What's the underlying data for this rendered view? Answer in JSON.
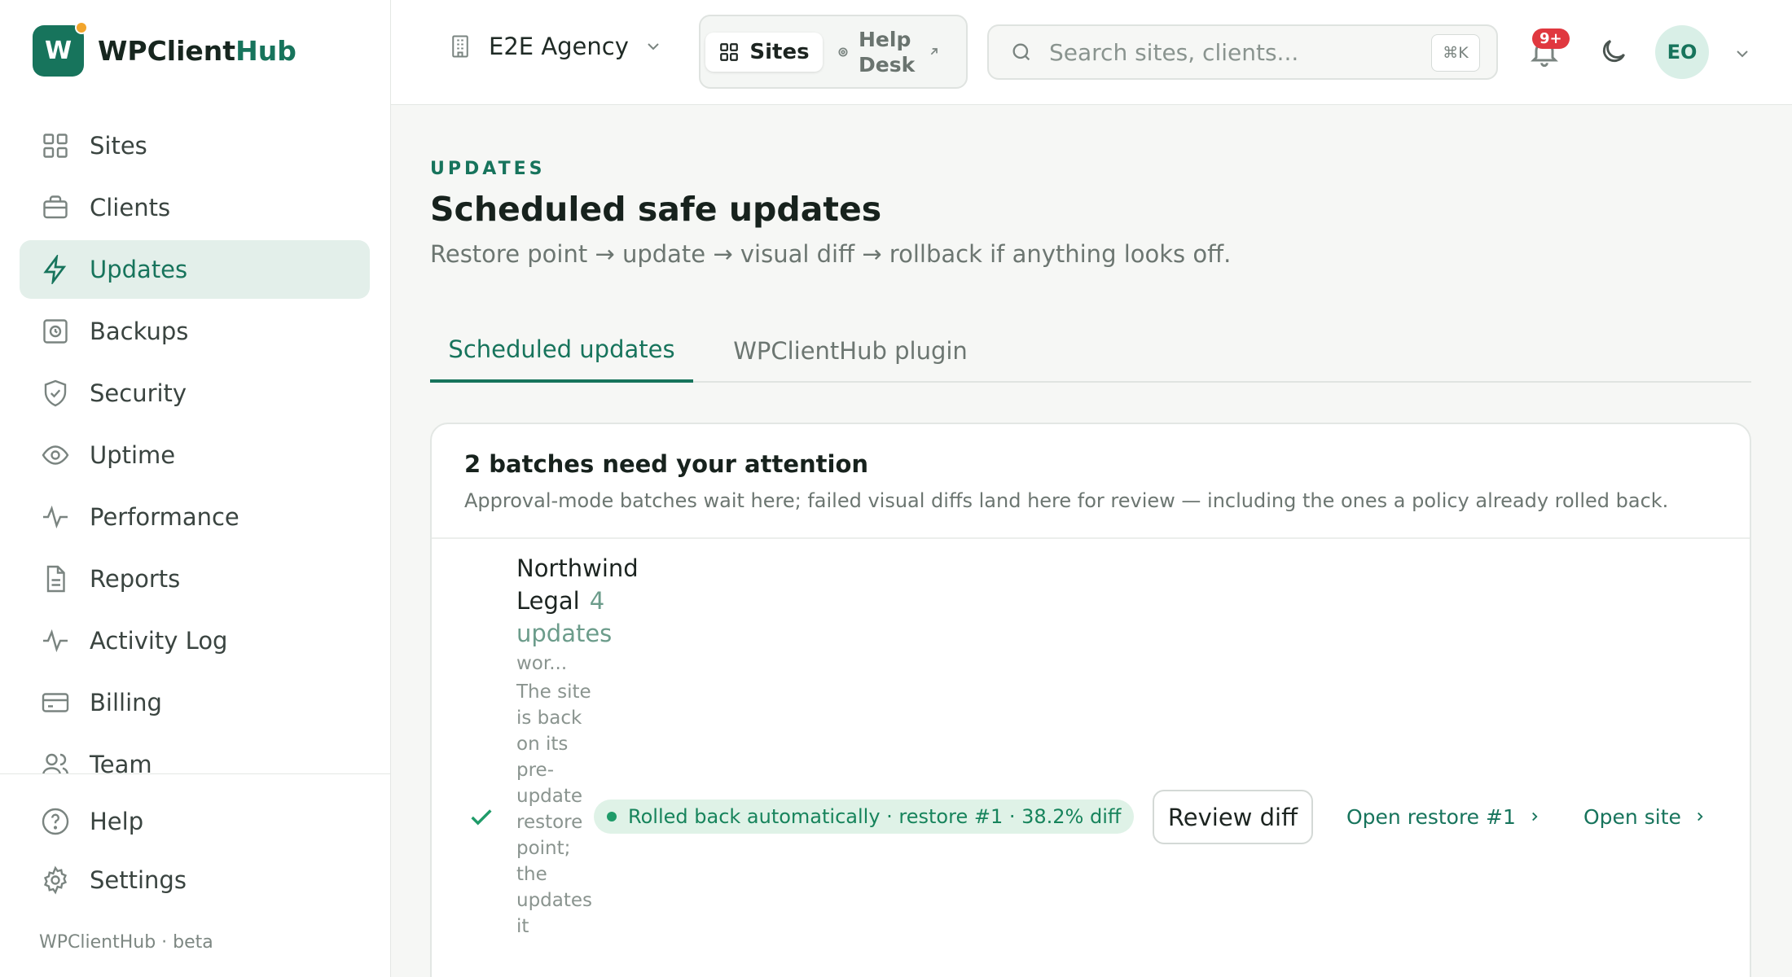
{
  "brand": {
    "initial": "W",
    "name_part1": "WPClient",
    "name_part2": "Hub"
  },
  "sidebar": {
    "items": [
      {
        "label": "Sites",
        "icon": "grid-icon"
      },
      {
        "label": "Clients",
        "icon": "briefcase-icon"
      },
      {
        "label": "Updates",
        "icon": "lightning-icon",
        "active": true
      },
      {
        "label": "Backups",
        "icon": "backup-icon"
      },
      {
        "label": "Security",
        "icon": "shield-icon"
      },
      {
        "label": "Uptime",
        "icon": "eye-icon"
      },
      {
        "label": "Performance",
        "icon": "pulse-icon"
      },
      {
        "label": "Reports",
        "icon": "document-icon"
      },
      {
        "label": "Activity Log",
        "icon": "activity-icon"
      },
      {
        "label": "Billing",
        "icon": "card-icon"
      },
      {
        "label": "Team",
        "icon": "users-icon"
      }
    ],
    "bottom": [
      {
        "label": "Help",
        "icon": "help-icon"
      },
      {
        "label": "Settings",
        "icon": "gear-icon"
      }
    ],
    "footer": "WPClientHub · beta"
  },
  "topbar": {
    "agency": "E2E Agency",
    "seg_sites": "Sites",
    "seg_help": "Help Desk",
    "search_placeholder": "Search sites, clients...",
    "shortcut": "⌘K",
    "notifications_badge": "9+",
    "avatar": "EO"
  },
  "page": {
    "eyebrow": "UPDATES",
    "title": "Scheduled safe updates",
    "subtitle": "Restore point → update → visual diff → rollback if anything looks off."
  },
  "tabs": [
    {
      "label": "Scheduled updates",
      "active": true
    },
    {
      "label": "WPClientHub plugin",
      "active": false
    }
  ],
  "attention": {
    "title": "2 batches need your attention",
    "description": "Approval-mode batches wait here; failed visual diffs land here for review — including the ones a policy already rolled back.",
    "rows": [
      {
        "site": "Northwind Legal",
        "count": "4 updates",
        "sub": "wor...",
        "message": "The site is back on its pre-update restore point; the updates it",
        "status": "Rolled back automatically · restore #1 · 38.2% diff",
        "status_color": "#17845c",
        "review_label": "Review diff",
        "restore_link": "Open restore #1",
        "site_link": "Open site"
      }
    ]
  },
  "colors": {
    "accent": "#17745c",
    "badge": "#e0383f",
    "status_bg": "#dff2e7"
  }
}
